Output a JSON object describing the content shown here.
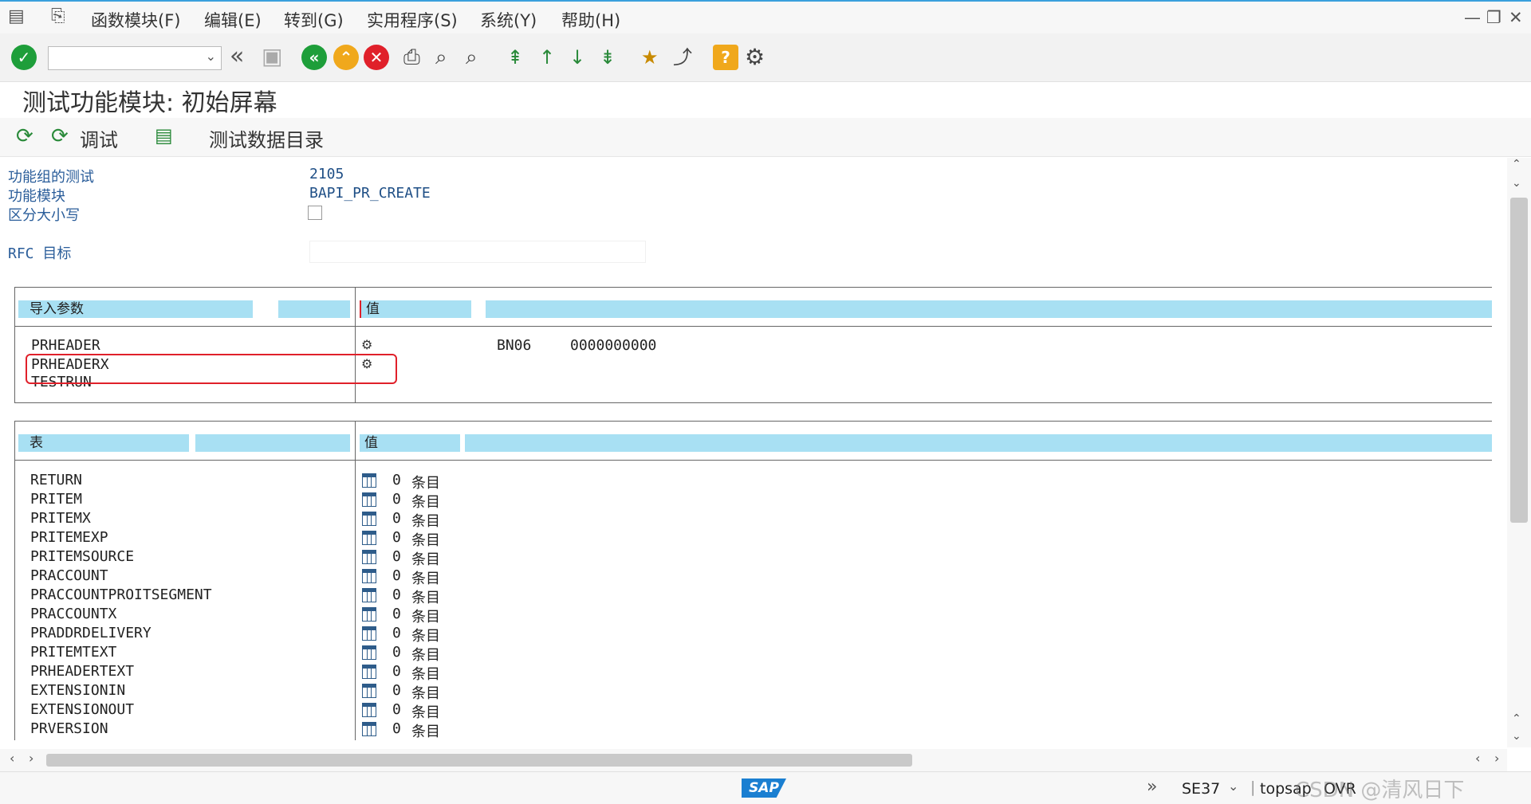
{
  "menu": {
    "items": [
      "函数模块(F)",
      "编辑(E)",
      "转到(G)",
      "实用程序(S)",
      "系统(Y)",
      "帮助(H)"
    ]
  },
  "toolbar": {
    "command_field_value": ""
  },
  "screen": {
    "title": "测试功能模块: 初始屏幕"
  },
  "app_toolbar": {
    "debug_label": "调试",
    "test_data_label": "测试数据目录"
  },
  "fields": {
    "function_group_label": "功能组的测试",
    "function_group_value": "2105",
    "function_module_label": "功能模块",
    "function_module_value": "BAPI_PR_CREATE",
    "case_sensitive_label": "区分大小写",
    "rfc_target_label": "RFC 目标",
    "rfc_target_value": ""
  },
  "import_params": {
    "header_name": "导入参数",
    "header_value": "值",
    "rows": [
      {
        "name": "PRHEADER",
        "type": "BN06",
        "value": "0000000000"
      },
      {
        "name": "PRHEADERX",
        "type": "",
        "value": ""
      },
      {
        "name": "TESTRUN",
        "type": "",
        "value": ""
      }
    ]
  },
  "tables": {
    "header_name": "表",
    "header_value": "值",
    "rows": [
      {
        "name": "RETURN",
        "count": "0",
        "unit": "条目"
      },
      {
        "name": "PRITEM",
        "count": "0",
        "unit": "条目"
      },
      {
        "name": "PRITEMX",
        "count": "0",
        "unit": "条目"
      },
      {
        "name": "PRITEMEXP",
        "count": "0",
        "unit": "条目"
      },
      {
        "name": "PRITEMSOURCE",
        "count": "0",
        "unit": "条目"
      },
      {
        "name": "PRACCOUNT",
        "count": "0",
        "unit": "条目"
      },
      {
        "name": "PRACCOUNTPROITSEGMENT",
        "count": "0",
        "unit": "条目"
      },
      {
        "name": "PRACCOUNTX",
        "count": "0",
        "unit": "条目"
      },
      {
        "name": "PRADDRDELIVERY",
        "count": "0",
        "unit": "条目"
      },
      {
        "name": "PRITEMTEXT",
        "count": "0",
        "unit": "条目"
      },
      {
        "name": "PRHEADERTEXT",
        "count": "0",
        "unit": "条目"
      },
      {
        "name": "EXTENSIONIN",
        "count": "0",
        "unit": "条目"
      },
      {
        "name": "EXTENSIONOUT",
        "count": "0",
        "unit": "条目"
      },
      {
        "name": "PRVERSION",
        "count": "0",
        "unit": "条目"
      }
    ]
  },
  "status": {
    "logo": "SAP",
    "transaction": "SE37",
    "system": "topsap",
    "mode": "OVR",
    "watermark": "CSDN @清风日下"
  },
  "colors": {
    "header_bg": "#a8e0f3",
    "highlight": "#e0202a",
    "ok_green": "#1e9e3a"
  }
}
